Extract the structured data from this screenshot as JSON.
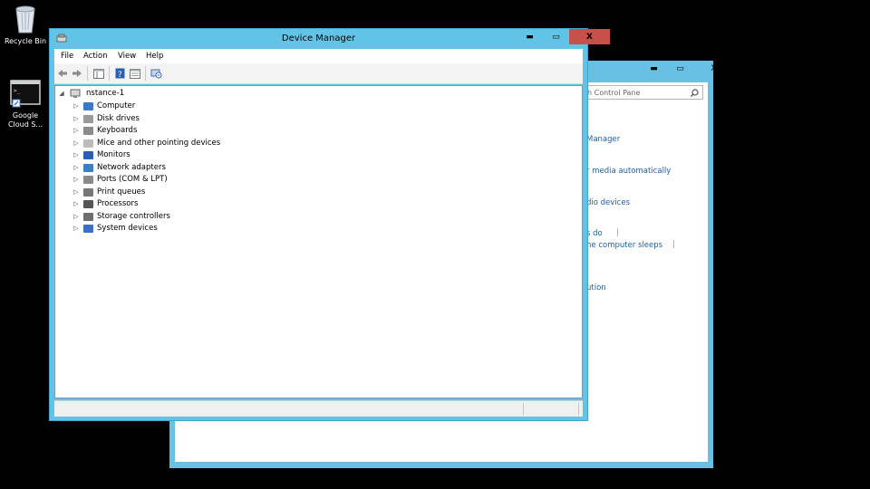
{
  "desktop": {
    "icons": [
      {
        "name": "recycle-bin",
        "label": "Recycle Bin"
      },
      {
        "name": "google-cloud-sdk",
        "label": "Google Cloud S..."
      }
    ]
  },
  "control_panel": {
    "search_placeholder": "h Control Pane",
    "links": [
      "Manager",
      "r media automatically",
      "dio devices",
      "s do",
      "he computer sleeps",
      "ution"
    ],
    "caption": {
      "minimize": "▬",
      "maximize": "▭",
      "close": "X"
    }
  },
  "device_manager": {
    "title": "Device Manager",
    "caption": {
      "minimize": "▬",
      "maximize": "▭",
      "close": "X"
    },
    "menu": [
      "File",
      "Action",
      "View",
      "Help"
    ],
    "tree": {
      "root": "nstance-1",
      "items": [
        {
          "label": "Computer",
          "icon": "computer-icon",
          "color": "#3b78c7"
        },
        {
          "label": "Disk drives",
          "icon": "disk-drive-icon",
          "color": "#9a9a9a"
        },
        {
          "label": "Keyboards",
          "icon": "keyboard-icon",
          "color": "#8b8b8b"
        },
        {
          "label": "Mice and other pointing devices",
          "icon": "mouse-icon",
          "color": "#bcbcbc"
        },
        {
          "label": "Monitors",
          "icon": "monitor-icon",
          "color": "#2b5fb0"
        },
        {
          "label": "Network adapters",
          "icon": "network-adapter-icon",
          "color": "#3a7fc3"
        },
        {
          "label": "Ports (COM & LPT)",
          "icon": "port-icon",
          "color": "#8a8a8a"
        },
        {
          "label": "Print queues",
          "icon": "printer-icon",
          "color": "#777777"
        },
        {
          "label": "Processors",
          "icon": "processor-icon",
          "color": "#555555"
        },
        {
          "label": "Storage controllers",
          "icon": "storage-controller-icon",
          "color": "#6e6e6e"
        },
        {
          "label": "System devices",
          "icon": "system-device-icon",
          "color": "#3b6fc0"
        }
      ]
    },
    "toolbar_icons": [
      "back-arrow-icon",
      "forward-arrow-icon",
      "show-hide-console-tree-icon",
      "help-icon",
      "properties-icon",
      "scan-hardware-icon"
    ]
  }
}
